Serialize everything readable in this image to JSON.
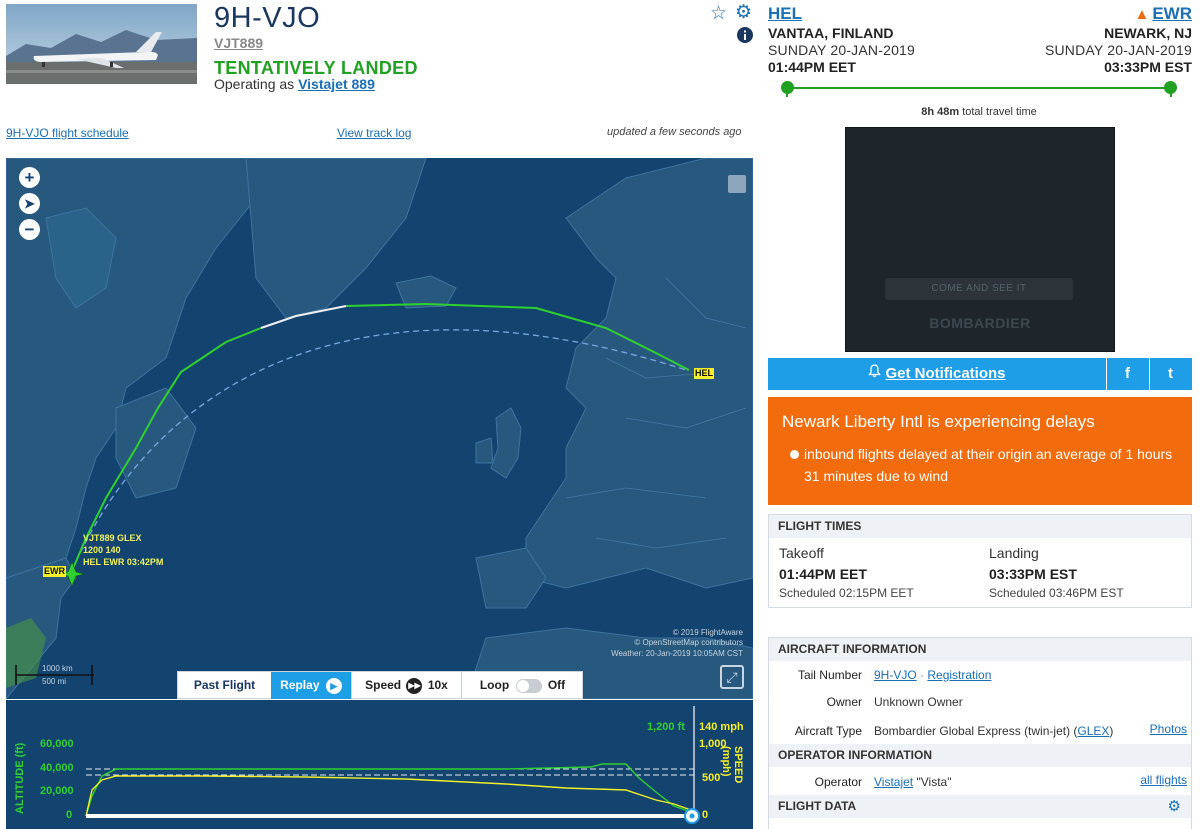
{
  "header": {
    "tail_number": "9H-VJO",
    "ident": "VJT889",
    "status": "TENTATIVELY LANDED",
    "operating_prefix": "Operating as",
    "operating_flight": "Vistajet 889"
  },
  "icons": {
    "star": "star-icon",
    "gear": "gear-icon",
    "info": "info-icon",
    "warning": "warning-icon",
    "bell": "bell-icon"
  },
  "links": {
    "schedule": "9H-VJO flight schedule",
    "track_log": "View track log",
    "updated": "updated a few seconds ago"
  },
  "route": {
    "origin": {
      "code": "HEL",
      "city": "VANTAA, FINLAND",
      "date": "SUNDAY 20-JAN-2019",
      "time": "01:44PM EET"
    },
    "destination": {
      "code": "EWR",
      "city": "NEWARK, NJ",
      "date": "SUNDAY 20-JAN-2019",
      "time": "03:33PM EST"
    },
    "travel_time": "8h 48m",
    "travel_suffix": "total travel time",
    "progress": 1.0
  },
  "ad": {
    "cta": "COME AND SEE IT",
    "brand": "BOMBARDIER"
  },
  "notifications": {
    "label": "Get Notifications",
    "facebook": "f",
    "twitter": "t"
  },
  "alert": {
    "title": "Newark Liberty Intl is experiencing delays",
    "detail": "inbound flights delayed at their origin an average of 1 hours 31 minutes due to wind"
  },
  "flight_times": {
    "header": "FLIGHT TIMES",
    "takeoff": {
      "label": "Takeoff",
      "time": "01:44PM EET",
      "scheduled": "Scheduled 02:15PM EET"
    },
    "landing": {
      "label": "Landing",
      "time": "03:33PM EST",
      "scheduled": "Scheduled 03:46PM EST"
    }
  },
  "aircraft": {
    "header": "AIRCRAFT INFORMATION",
    "tail_label": "Tail Number",
    "tail_value": "9H-VJO",
    "sep": "·",
    "registration": "Registration",
    "owner_label": "Owner",
    "owner_value": "Unknown Owner",
    "type_label": "Aircraft Type",
    "type_value": "Bombardier Global Express (twin-jet) (",
    "type_code": "GLEX",
    "type_close": ")",
    "photos": "Photos"
  },
  "operator": {
    "header": "OPERATOR INFORMATION",
    "label": "Operator",
    "value": "Vistajet",
    "alias": "\"Vista\"",
    "all_flights": "all flights"
  },
  "flight_data": {
    "header": "FLIGHT DATA"
  },
  "map": {
    "origin_label": "HEL",
    "dest_label": "EWR",
    "flight_label_1": "VJT889 GLEX",
    "flight_label_2": "1200 140",
    "flight_label_3": "HEL EWR 03:42PM",
    "attribution_1": "© 2019 FlightAware",
    "attribution_2": "© OpenStreetMap contributors",
    "attribution_3": "Weather: 20-Jan-2019 10:05AM CST",
    "scale_km": "1000 km",
    "scale_mi": "500 mi"
  },
  "controls": {
    "past_flight": "Past Flight",
    "replay": "Replay",
    "speed": "Speed",
    "speed_value": "10x",
    "loop": "Loop",
    "loop_state": "Off"
  },
  "graph": {
    "altitude_label": "ALTITUDE (ft)",
    "speed_label": "SPEED (mph)",
    "current_alt": "1,200 ft",
    "current_speed": "140 mph",
    "alt_ticks": [
      "60,000",
      "40,000",
      "20,000",
      "0"
    ],
    "speed_ticks": [
      "1,000",
      "500",
      "0"
    ]
  },
  "colors": {
    "accent": "#1a6fb5",
    "landed": "#21a121",
    "alert": "#f26c0e",
    "map_water": "#13436f",
    "notify": "#1e9ee6"
  }
}
